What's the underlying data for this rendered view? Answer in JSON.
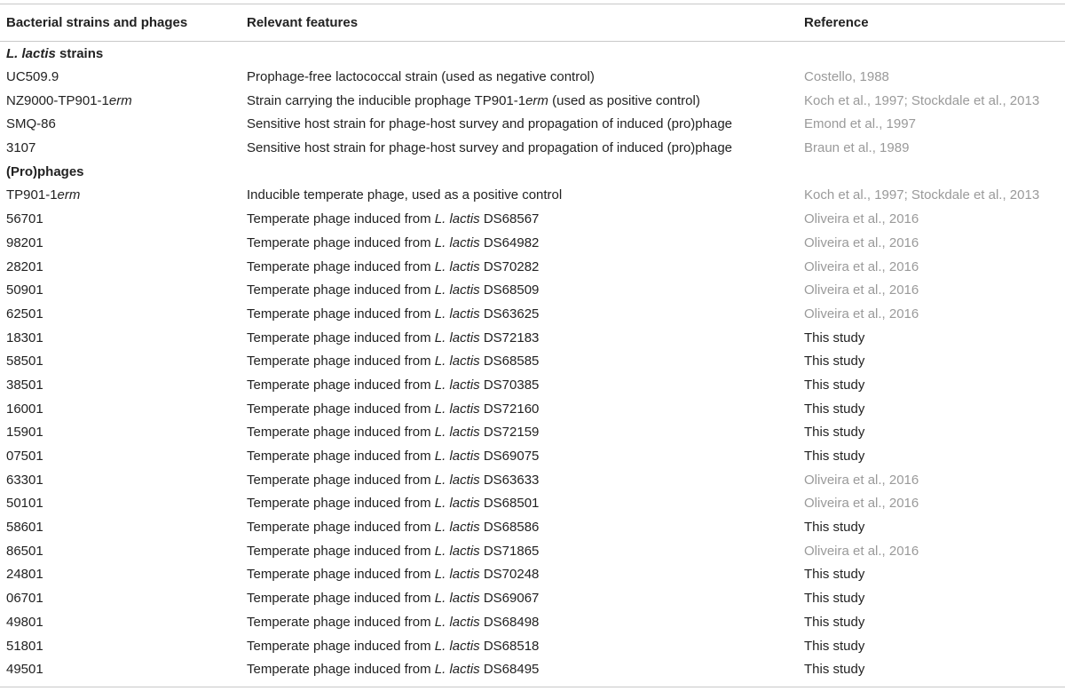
{
  "header": {
    "col1": "Bacterial strains and phages",
    "col2": "Relevant features",
    "col3": "Reference"
  },
  "sections": [
    {
      "title": {
        "italic": "L. lactis",
        "rest": " strains"
      },
      "rows": [
        {
          "name": "UC509.9",
          "name_italic": "",
          "feature": "Prophage-free lactococcal strain (used as negative control)",
          "feature_type": "plain",
          "ref": "Costello, 1988",
          "ref_style": "cited"
        },
        {
          "name": "NZ9000-TP901-1",
          "name_italic": "erm",
          "feature_pre": "Strain carrying the inducible prophage TP901-1",
          "feature_italic": "erm",
          "feature_post": " (used as positive control)",
          "feature_type": "mixed",
          "ref": "Koch et al., 1997; Stockdale et al., 2013",
          "ref_style": "cited"
        },
        {
          "name": "SMQ-86",
          "name_italic": "",
          "feature": "Sensitive host strain for phage-host survey and propagation of induced (pro)phage",
          "feature_type": "plain",
          "ref": "Emond et al., 1997",
          "ref_style": "cited"
        },
        {
          "name": "3107",
          "name_italic": "",
          "feature": "Sensitive host strain for phage-host survey and propagation of induced (pro)phage",
          "feature_type": "plain",
          "ref": "Braun et al., 1989",
          "ref_style": "cited"
        }
      ]
    },
    {
      "title": {
        "italic": "",
        "rest": "(Pro)phages"
      },
      "rows": [
        {
          "name": "TP901-1",
          "name_italic": "erm",
          "feature": "Inducible temperate phage, used as a positive control",
          "feature_type": "plain",
          "ref": "Koch et al., 1997; Stockdale et al., 2013",
          "ref_style": "cited"
        },
        {
          "name": "56701",
          "name_italic": "",
          "feature_type": "induced",
          "strain": "DS68567",
          "ref": "Oliveira et al., 2016",
          "ref_style": "cited"
        },
        {
          "name": "98201",
          "name_italic": "",
          "feature_type": "induced",
          "strain": "DS64982",
          "ref": "Oliveira et al., 2016",
          "ref_style": "cited"
        },
        {
          "name": "28201",
          "name_italic": "",
          "feature_type": "induced",
          "strain": "DS70282",
          "ref": "Oliveira et al., 2016",
          "ref_style": "cited"
        },
        {
          "name": "50901",
          "name_italic": "",
          "feature_type": "induced",
          "strain": "DS68509",
          "ref": "Oliveira et al., 2016",
          "ref_style": "cited"
        },
        {
          "name": "62501",
          "name_italic": "",
          "feature_type": "induced",
          "strain": "DS63625",
          "ref": "Oliveira et al., 2016",
          "ref_style": "cited"
        },
        {
          "name": "18301",
          "name_italic": "",
          "feature_type": "induced",
          "strain": "DS72183",
          "ref": "This study",
          "ref_style": "plain"
        },
        {
          "name": "58501",
          "name_italic": "",
          "feature_type": "induced",
          "strain": "DS68585",
          "ref": "This study",
          "ref_style": "plain"
        },
        {
          "name": "38501",
          "name_italic": "",
          "feature_type": "induced",
          "strain": "DS70385",
          "ref": "This study",
          "ref_style": "plain"
        },
        {
          "name": "16001",
          "name_italic": "",
          "feature_type": "induced",
          "strain": "DS72160",
          "ref": "This study",
          "ref_style": "plain"
        },
        {
          "name": "15901",
          "name_italic": "",
          "feature_type": "induced",
          "strain": "DS72159",
          "ref": "This study",
          "ref_style": "plain"
        },
        {
          "name": "07501",
          "name_italic": "",
          "feature_type": "induced",
          "strain": "DS69075",
          "ref": "This study",
          "ref_style": "plain"
        },
        {
          "name": "63301",
          "name_italic": "",
          "feature_type": "induced",
          "strain": "DS63633",
          "ref": "Oliveira et al., 2016",
          "ref_style": "cited"
        },
        {
          "name": "50101",
          "name_italic": "",
          "feature_type": "induced",
          "strain": "DS68501",
          "ref": "Oliveira et al., 2016",
          "ref_style": "cited"
        },
        {
          "name": "58601",
          "name_italic": "",
          "feature_type": "induced",
          "strain": "DS68586",
          "ref": "This study",
          "ref_style": "plain"
        },
        {
          "name": "86501",
          "name_italic": "",
          "feature_type": "induced",
          "strain": "DS71865",
          "ref": "Oliveira et al., 2016",
          "ref_style": "cited"
        },
        {
          "name": "24801",
          "name_italic": "",
          "feature_type": "induced",
          "strain": "DS70248",
          "ref": "This study",
          "ref_style": "plain"
        },
        {
          "name": "06701",
          "name_italic": "",
          "feature_type": "induced",
          "strain": "DS69067",
          "ref": "This study",
          "ref_style": "plain"
        },
        {
          "name": "49801",
          "name_italic": "",
          "feature_type": "induced",
          "strain": "DS68498",
          "ref": "This study",
          "ref_style": "plain"
        },
        {
          "name": "51801",
          "name_italic": "",
          "feature_type": "induced",
          "strain": "DS68518",
          "ref": "This study",
          "ref_style": "plain"
        },
        {
          "name": "49501",
          "name_italic": "",
          "feature_type": "induced",
          "strain": "DS68495",
          "ref": "This study",
          "ref_style": "plain"
        }
      ]
    }
  ],
  "induced_template": {
    "prefix": "Temperate phage induced from ",
    "species_italic": "L. lactis",
    "space": " "
  },
  "colors": {
    "text": "#222222",
    "reference_link": "#9a9a9a",
    "rule": "#c8c8c8"
  }
}
